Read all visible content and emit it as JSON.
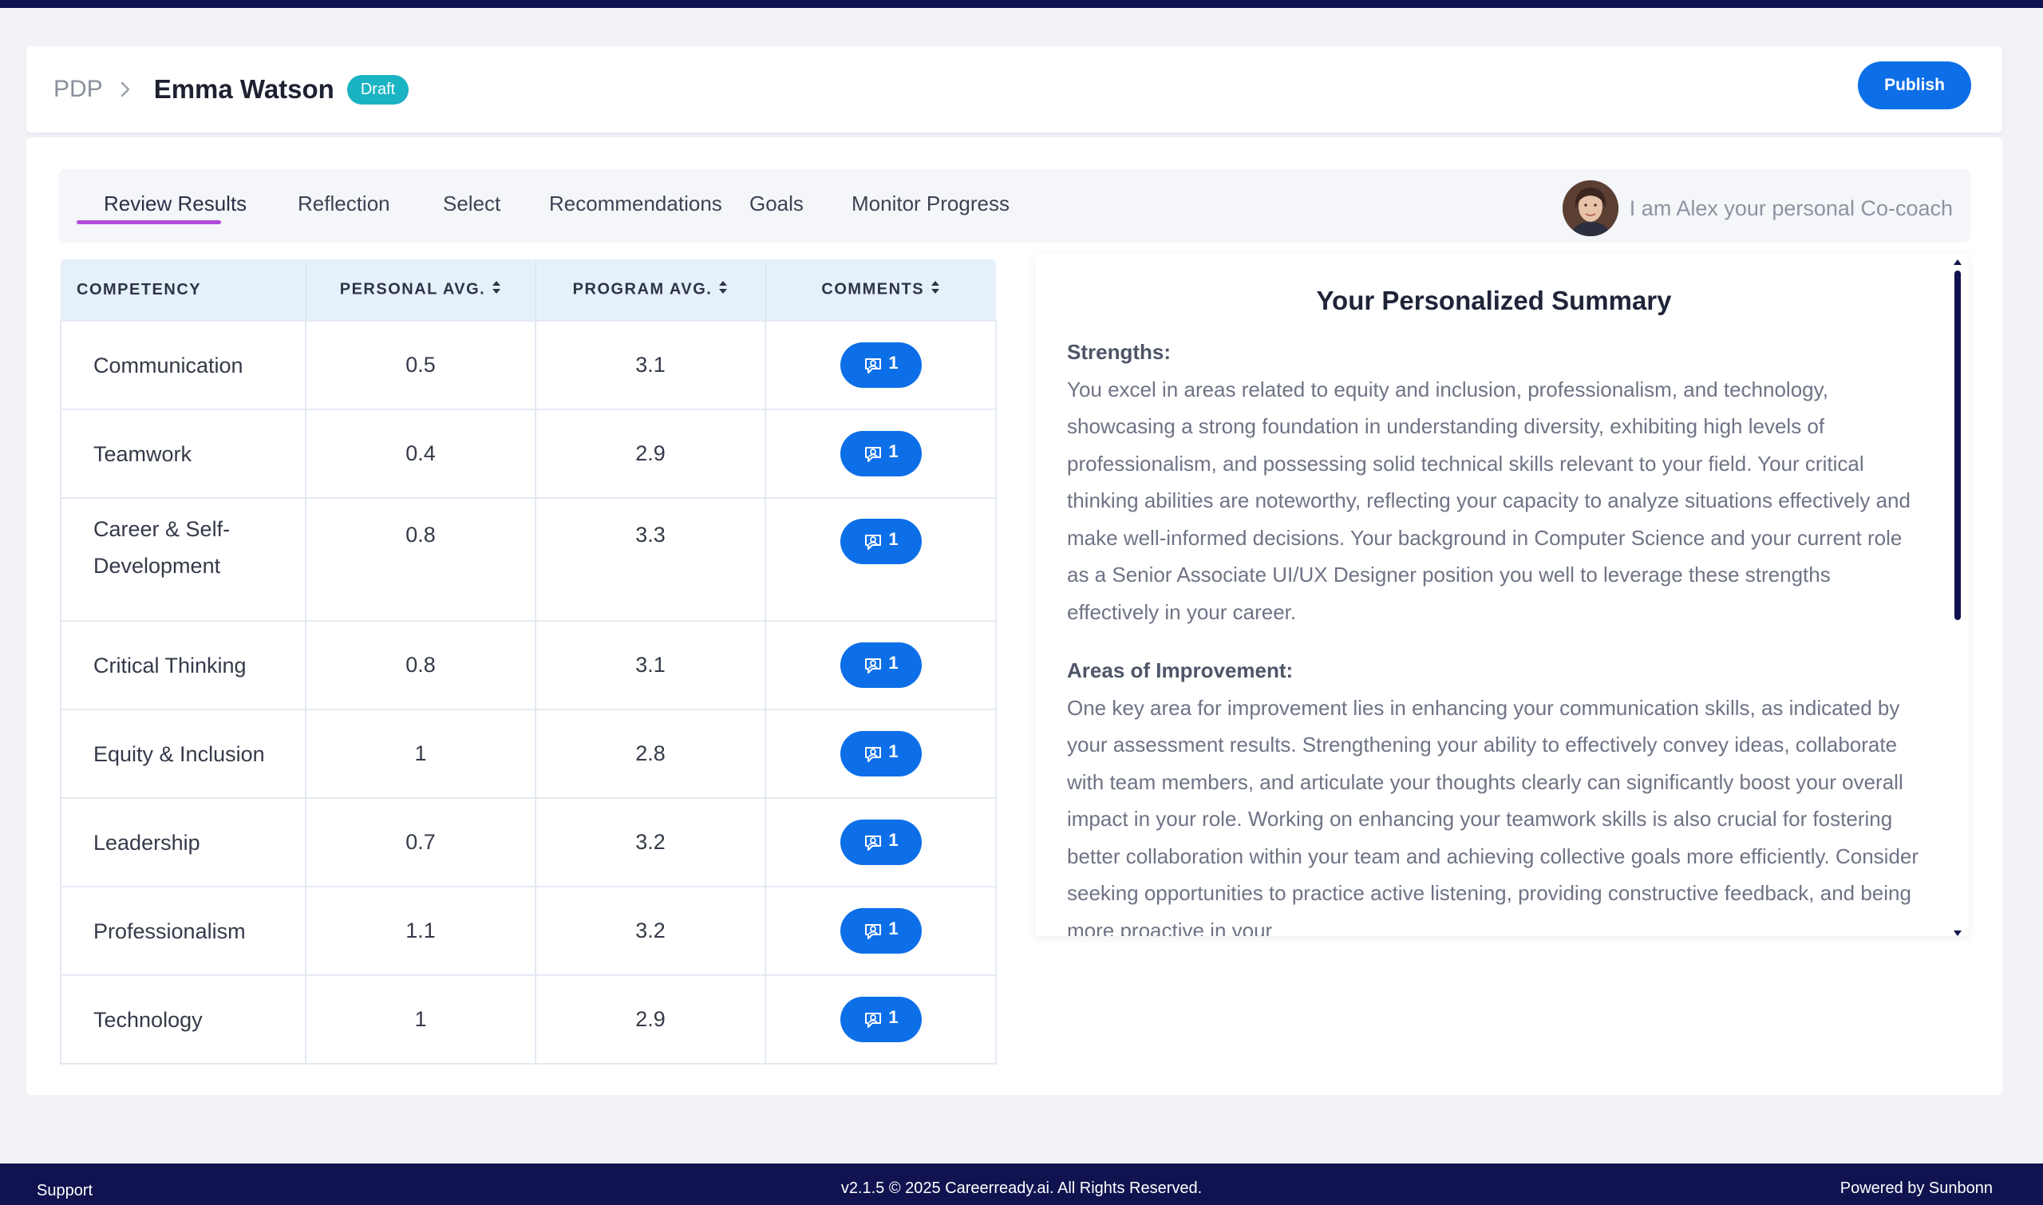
{
  "header": {
    "breadcrumb_root": "PDP",
    "name": "Emma Watson",
    "status_badge": "Draft",
    "publish_label": "Publish"
  },
  "tabs": [
    {
      "label": "Review Results",
      "active": true
    },
    {
      "label": "Reflection",
      "active": false
    },
    {
      "label": "Select",
      "active": false
    },
    {
      "label": "Recommendations",
      "active": false
    },
    {
      "label": "Goals",
      "active": false
    },
    {
      "label": "Monitor Progress",
      "active": false
    }
  ],
  "coach": {
    "text": "I am Alex your personal Co-coach"
  },
  "table": {
    "headers": [
      "COMPETENCY",
      "PERSONAL AVG.",
      "PROGRAM AVG.",
      "COMMENTS"
    ],
    "rows": [
      {
        "competency": "Communication",
        "personal": "0.5",
        "program": "3.1",
        "comments": "1"
      },
      {
        "competency": "Teamwork",
        "personal": "0.4",
        "program": "2.9",
        "comments": "1"
      },
      {
        "competency": "Career & Self-Development",
        "personal": "0.8",
        "program": "3.3",
        "comments": "1"
      },
      {
        "competency": "Critical Thinking",
        "personal": "0.8",
        "program": "3.1",
        "comments": "1"
      },
      {
        "competency": "Equity & Inclusion",
        "personal": "1",
        "program": "2.8",
        "comments": "1"
      },
      {
        "competency": "Leadership",
        "personal": "0.7",
        "program": "3.2",
        "comments": "1"
      },
      {
        "competency": "Professionalism",
        "personal": "1.1",
        "program": "3.2",
        "comments": "1"
      },
      {
        "competency": "Technology",
        "personal": "1",
        "program": "2.9",
        "comments": "1"
      }
    ]
  },
  "summary": {
    "title": "Your Personalized Summary",
    "strengths_heading": "Strengths",
    "strengths_text": "You excel in areas related to equity and inclusion, professionalism, and technology, showcasing a strong foundation in understanding diversity, exhibiting high levels of professionalism, and possessing solid technical skills relevant to your field. Your critical thinking abilities are noteworthy, reflecting your capacity to analyze situations effectively and make well-informed decisions. Your background in Computer Science and your current role as a Senior Associate UI/UX Designer position you well to leverage these strengths effectively in your career.",
    "improvement_heading": "Areas of Improvement",
    "improvement_text": "One key area for improvement lies in enhancing your communication skills, as indicated by your assessment results. Strengthening your ability to effectively convey ideas, collaborate with team members, and articulate your thoughts clearly can significantly boost your overall impact in your role. Working on enhancing your teamwork skills is also crucial for fostering better collaboration within your team and achieving collective goals more efficiently. Consider seeking opportunities to practice active listening, providing constructive feedback, and being more proactive in your"
  },
  "footer": {
    "support": "Support",
    "copyright": "v2.1.5 © 2025 Careerready.ai. All Rights Reserved.",
    "powered": "Powered by Sunbonn"
  },
  "colors": {
    "primary_button": "#0d6fe8",
    "badge": "#1ab3c3",
    "active_tab_underline": "#b04adb",
    "navy": "#10134f"
  }
}
